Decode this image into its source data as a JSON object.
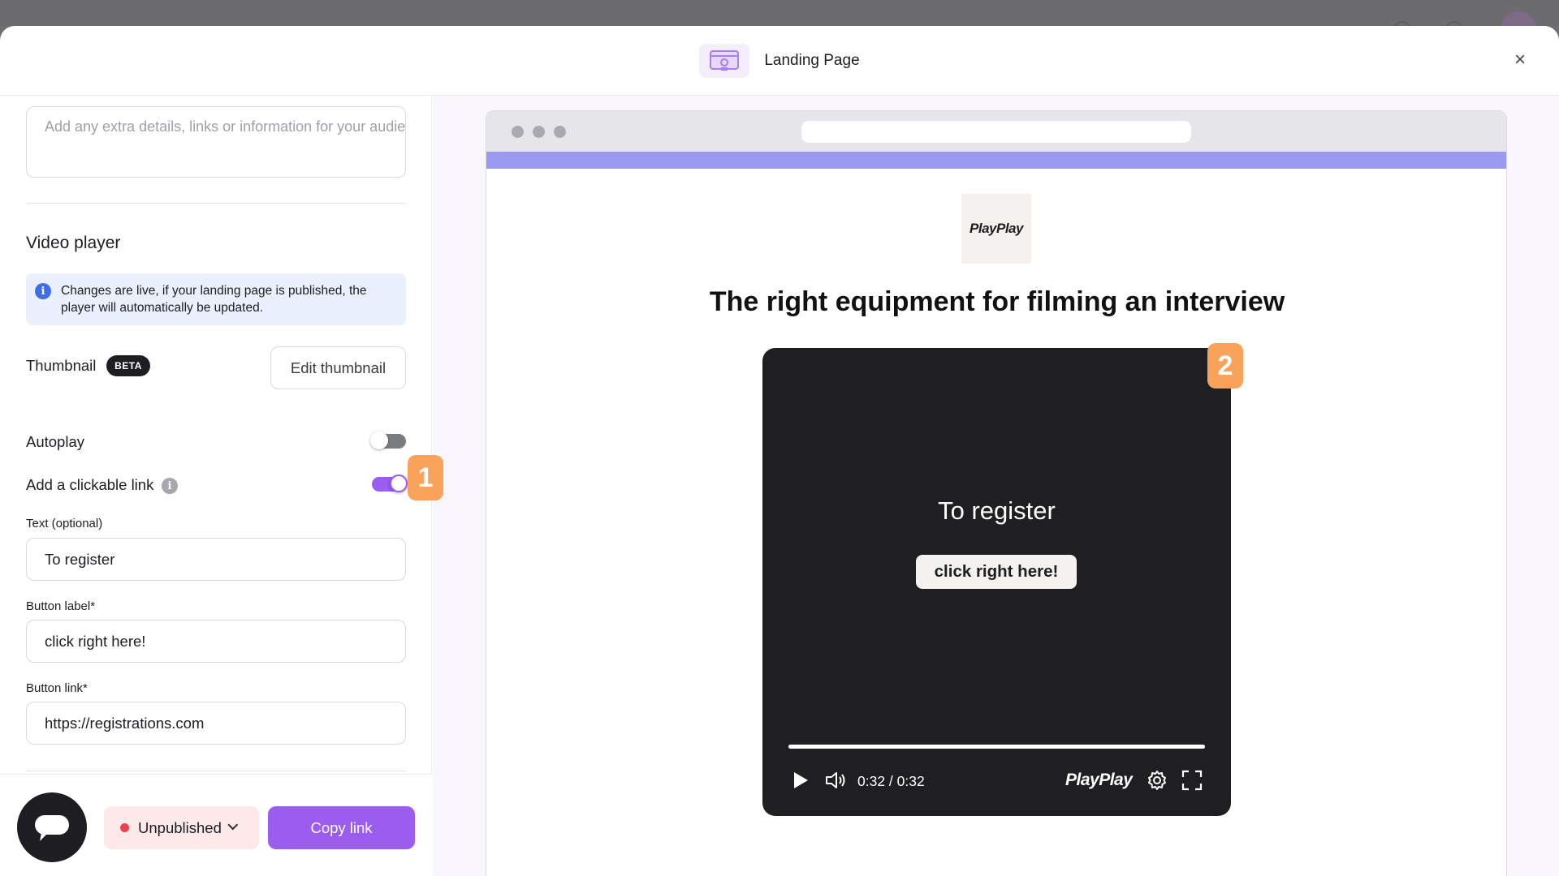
{
  "header": {
    "title": "Landing Page",
    "close_label": "×"
  },
  "left": {
    "description_placeholder": "Add any extra details, links or information for your audience",
    "video_player": {
      "title": "Video player",
      "info_text": "Changes are live, if your landing page is published, the player will automatically be updated.",
      "thumbnail_label": "Thumbnail",
      "beta_badge": "BETA",
      "edit_thumbnail_button": "Edit thumbnail",
      "autoplay_label": "Autoplay",
      "autoplay_on": false,
      "clickable_link_label": "Add a clickable link",
      "clickable_link_on": true,
      "text_field_label": "Text (optional)",
      "text_field_value": "To register",
      "button_label_field_label": "Button label*",
      "button_label_value": "click right here!",
      "button_link_field_label": "Button link*",
      "button_link_value": "https://registrations.com"
    },
    "footer": {
      "status_label": "Unpublished",
      "copy_link_button": "Copy link"
    }
  },
  "badges": {
    "step_1": "1",
    "step_2": "2"
  },
  "preview": {
    "logo_text": "PlayPlay",
    "heading": "The right equipment for filming an interview",
    "video": {
      "overlay_text": "To register",
      "cta_label": "click right here!",
      "time": "0:32 / 0:32",
      "progress": 1.0,
      "brand": "PlayPlay"
    }
  },
  "colors": {
    "accent_purple": "#9b5cf0",
    "step_badge": "#f9a25a",
    "status_red": "#e8434c",
    "info_blue": "#3f6ee8",
    "strip": "#9a9af2"
  },
  "icons": {
    "header": "landing-page-icon",
    "close": "close-icon",
    "info": "info-icon",
    "help": "help-icon",
    "chat": "chat-icon",
    "play": "play-icon",
    "volume": "volume-icon",
    "settings": "gear-icon",
    "fullscreen": "fullscreen-icon"
  }
}
